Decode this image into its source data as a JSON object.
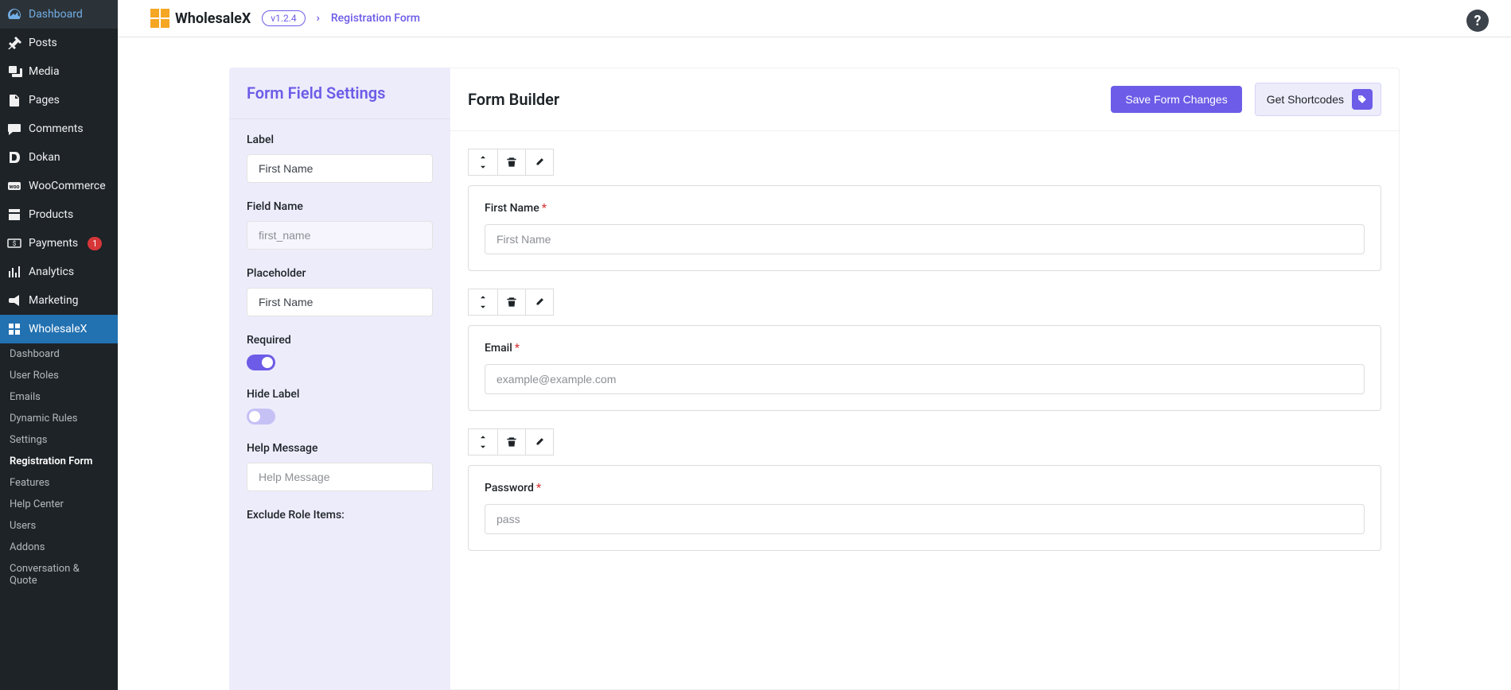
{
  "sidebar": {
    "items": [
      {
        "id": "dashboard",
        "label": "Dashboard"
      },
      {
        "id": "posts",
        "label": "Posts"
      },
      {
        "id": "media",
        "label": "Media"
      },
      {
        "id": "pages",
        "label": "Pages"
      },
      {
        "id": "comments",
        "label": "Comments"
      },
      {
        "id": "dokan",
        "label": "Dokan"
      },
      {
        "id": "woocommerce",
        "label": "WooCommerce"
      },
      {
        "id": "products",
        "label": "Products"
      },
      {
        "id": "payments",
        "label": "Payments",
        "badge": "1"
      },
      {
        "id": "analytics",
        "label": "Analytics"
      },
      {
        "id": "marketing",
        "label": "Marketing"
      },
      {
        "id": "wholesalex",
        "label": "WholesaleX"
      }
    ],
    "submenu": [
      {
        "label": "Dashboard"
      },
      {
        "label": "User Roles"
      },
      {
        "label": "Emails"
      },
      {
        "label": "Dynamic Rules"
      },
      {
        "label": "Settings"
      },
      {
        "label": "Registration Form",
        "current": true
      },
      {
        "label": "Features"
      },
      {
        "label": "Help Center"
      },
      {
        "label": "Users"
      },
      {
        "label": "Addons"
      },
      {
        "label": "Conversation & Quote"
      }
    ]
  },
  "topbar": {
    "brand": "WholesaleX",
    "version": "v1.2.4",
    "breadcrumb": "Registration Form"
  },
  "settings": {
    "title": "Form Field Settings",
    "label_title": "Label",
    "label_value": "First Name",
    "fieldname_title": "Field Name",
    "fieldname_value": "first_name",
    "placeholder_title": "Placeholder",
    "placeholder_value": "First Name",
    "required_title": "Required",
    "hidelabel_title": "Hide Label",
    "helpmsg_title": "Help Message",
    "helpmsg_placeholder": "Help Message",
    "exclude_title": "Exclude Role Items:"
  },
  "builder": {
    "title": "Form Builder",
    "save_label": "Save Form Changes",
    "shortcodes_label": "Get Shortcodes",
    "fields": [
      {
        "label": "First Name",
        "placeholder": "First Name",
        "required": true
      },
      {
        "label": "Email",
        "placeholder": "example@example.com",
        "required": true
      },
      {
        "label": "Password",
        "placeholder": "pass",
        "required": true
      }
    ]
  }
}
